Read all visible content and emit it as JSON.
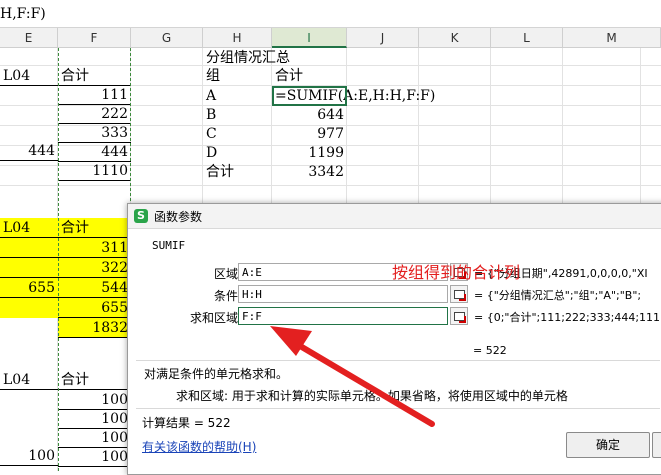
{
  "formula_bar": {
    "text": "H,F:F)"
  },
  "columns": [
    "E",
    "F",
    "G",
    "H",
    "I",
    "J",
    "K",
    "L",
    "M"
  ],
  "spreadsheet": {
    "e_col": [
      "L04",
      "",
      "",
      "444",
      "",
      "",
      "L04",
      "",
      "",
      "655",
      "",
      "",
      "L04",
      "",
      "",
      "",
      "100"
    ],
    "f_col": [
      "合计",
      "111",
      "222",
      "333",
      "444",
      "1110",
      "合计",
      "311",
      "322",
      "544",
      "655",
      "1832",
      "合计",
      "100",
      "100",
      "100",
      "100"
    ],
    "summary": {
      "title": "分组情况汇总",
      "header_group": "组",
      "header_total": "合计",
      "rows": [
        {
          "group": "A",
          "value": "=SUMIF(A:E,H:H,F:F)"
        },
        {
          "group": "B",
          "value": "644"
        },
        {
          "group": "C",
          "value": "977"
        },
        {
          "group": "D",
          "value": "1199"
        },
        {
          "group": "合计",
          "value": "3342"
        }
      ]
    }
  },
  "dialog": {
    "title": "函数参数",
    "function_name": "SUMIF",
    "args": [
      {
        "label": "区域",
        "value": "A:E",
        "result": "= {\"分组日期\",42891,0,0,0,0,\"XI"
      },
      {
        "label": "条件",
        "value": "H:H",
        "result": "= {\"分组情况汇总\";\"组\";\"A\";\"B\";"
      },
      {
        "label": "求和区域",
        "value": "F:F",
        "result": "= {0;\"合计\";111;222;333;444;111"
      }
    ],
    "formula_result": "= 522",
    "description": "对满足条件的单元格求和。",
    "param_desc": "求和区域:  用于求和计算的实际单元格。如果省略，将使用区域中的单元格",
    "calc_result": "计算结果 = 522",
    "help_link": "有关该函数的帮助(H)",
    "ok_button": "确定"
  },
  "annotation": {
    "text": "按组得到的合计列",
    "color": "#e32020"
  }
}
